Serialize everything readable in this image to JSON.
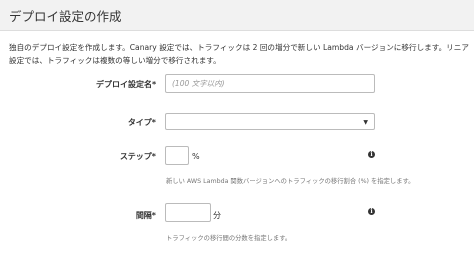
{
  "header": {
    "title": "デプロイ設定の作成"
  },
  "description": "独自のデプロイ設定を作成します。Canary 設定では、トラフィックは 2 回の増分で新しい Lambda バージョンに移行します。リニア設定では、トラフィックは複数の等しい増分で移行されます。",
  "form": {
    "name": {
      "label": "デプロイ設定名*",
      "placeholder": "(100 文字以内)",
      "value": ""
    },
    "type": {
      "label": "タイプ*",
      "selected": ""
    },
    "step": {
      "label": "ステップ*",
      "value": "",
      "unit": "%",
      "help": "新しい AWS Lambda 関数バージョンへのトラフィックの移行割合 (%) を指定します。"
    },
    "interval": {
      "label": "間隔*",
      "value": "",
      "unit": "分",
      "help": "トラフィックの移行間の分数を指定します。"
    }
  },
  "icons": {
    "info": "info-icon",
    "caret": "chevron-down-icon"
  }
}
